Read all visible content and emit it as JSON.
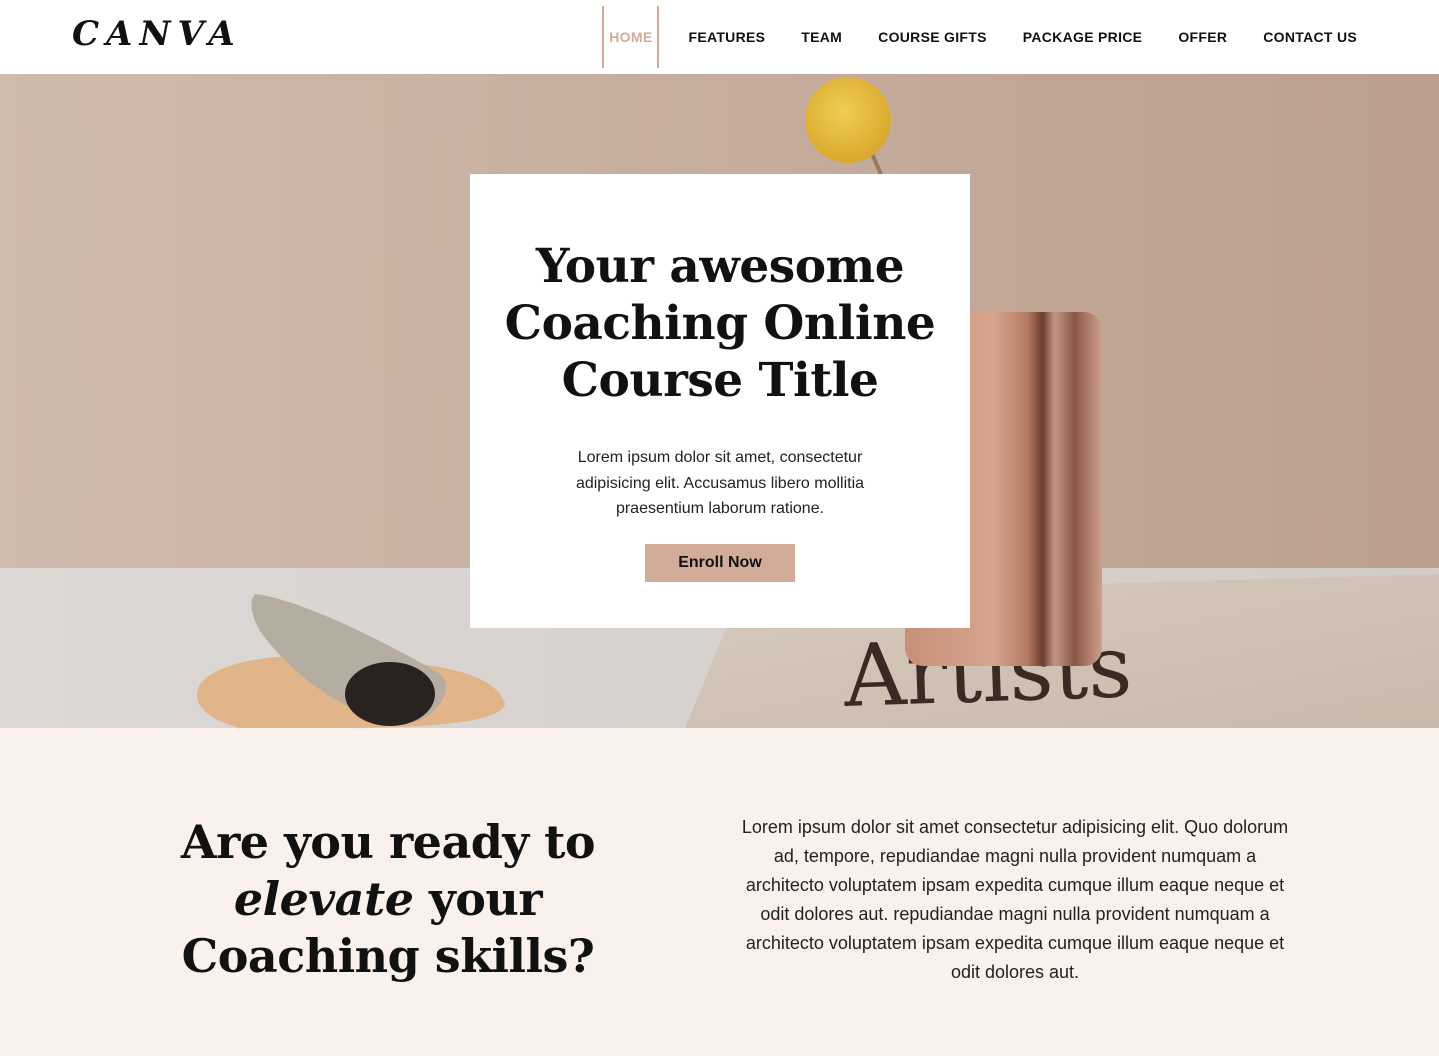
{
  "header": {
    "logo": "CANVA",
    "nav": [
      {
        "label": "HOME",
        "active": true
      },
      {
        "label": "FEATURES",
        "active": false
      },
      {
        "label": "TEAM",
        "active": false
      },
      {
        "label": "COURSE GIFTS",
        "active": false
      },
      {
        "label": "PACKAGE PRICE",
        "active": false
      },
      {
        "label": "OFFER",
        "active": false
      },
      {
        "label": "CONTACT US",
        "active": false
      }
    ]
  },
  "hero": {
    "title": "Your awesome Coaching Online Course Title",
    "text": "Lorem ipsum dolor sit amet, consectetur adipisicing elit. Accusamus libero mollitia praesentium laborum ratione.",
    "button": "Enroll Now",
    "book_text": "Artists"
  },
  "intro": {
    "heading_before": "Are you ready to",
    "heading_emphasis": "elevate",
    "heading_after": "your Coaching skills?",
    "text": "Lorem ipsum dolor sit amet consectetur adipisicing elit. Quo dolorum ad, tempore, repudiandae magni nulla provident numquam a architecto voluptatem ipsam expedita cumque illum eaque neque et odit dolores aut. repudiandae magni nulla provident numquam a architecto voluptatem ipsam expedita cumque illum eaque neque et odit dolores aut."
  },
  "colors": {
    "accent": "#d3ab99",
    "intro_background": "#fbf1ec",
    "text": "#111111"
  }
}
